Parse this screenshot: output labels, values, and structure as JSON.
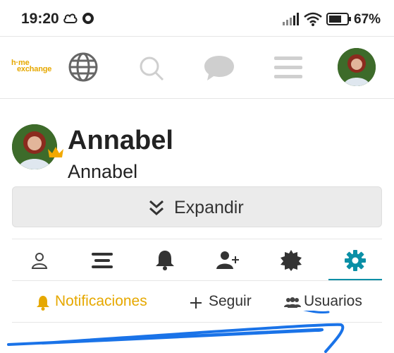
{
  "status_bar": {
    "time": "19:20",
    "battery": "67%",
    "icons": [
      "cloud-icon",
      "circle-icon",
      "signal-icon",
      "wifi-icon",
      "battery-icon"
    ]
  },
  "top_nav": {
    "logo_line1": "h·me",
    "logo_line2": "exchange",
    "items": [
      "globe-icon",
      "search-icon",
      "chat-icon",
      "menu-icon",
      "avatar"
    ]
  },
  "profile": {
    "name": "Annabel",
    "username": "Annabel"
  },
  "expand_button": {
    "label": "Expandir"
  },
  "tabs": [
    {
      "icon": "user-icon",
      "active": false
    },
    {
      "icon": "list-icon",
      "active": false
    },
    {
      "icon": "bell-icon",
      "active": false
    },
    {
      "icon": "add-user-icon",
      "active": false
    },
    {
      "icon": "badge-icon",
      "active": false
    },
    {
      "icon": "gear-icon",
      "active": true
    }
  ],
  "sub_tabs": [
    {
      "label": "Notificaciones",
      "icon": "bell-icon",
      "active": true
    },
    {
      "label": "Seguir",
      "icon": "plus-icon",
      "active": false
    },
    {
      "label": "Usuarios",
      "icon": "users-icon",
      "active": false
    }
  ],
  "colors": {
    "accent": "#e6a800",
    "active_tab": "#0a8fa6",
    "annotation": "#1a73e8"
  }
}
